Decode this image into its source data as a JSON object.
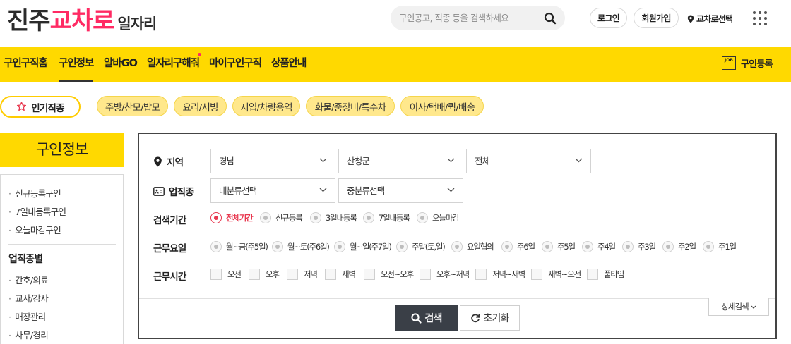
{
  "logo": {
    "part1": "진주",
    "part2": "교차로",
    "part3": "일자리"
  },
  "header": {
    "search_placeholder": "구인공고, 직종 등을 검색하세요",
    "login": "로그인",
    "join": "회원가입",
    "location": "교차로선택"
  },
  "nav": {
    "items": [
      "구인구직홈",
      "구인정보",
      "알바GO",
      "일자리구해줘",
      "마이구인구직",
      "상품안내"
    ],
    "active": "구인정보",
    "register": "구인등록",
    "job_icon_text": "JOB"
  },
  "chips": {
    "popular": "인기직종",
    "items": [
      "주방/찬모/밥모",
      "요리/서빙",
      "지입/차량용역",
      "화물/중장비/특수차",
      "이사/택배/퀵/배송"
    ]
  },
  "sidebar": {
    "title": "구인정보",
    "items": [
      "신규등록구인",
      "7일내등록구인",
      "오늘마감구인"
    ],
    "heading": "업직종별",
    "categories": [
      "간호/의료",
      "교사/강사",
      "매장관리",
      "사무/경리"
    ]
  },
  "filter": {
    "region": {
      "label": "지역",
      "selects": [
        "경남",
        "산청군",
        "전체"
      ]
    },
    "industry": {
      "label": "업직종",
      "selects": [
        "대분류선택",
        "중분류선택"
      ]
    },
    "period": {
      "label": "검색기간",
      "options": [
        "전체기간",
        "신규등록",
        "3일내등록",
        "7일내등록",
        "오늘마감"
      ],
      "selected": "전체기간"
    },
    "workdays": {
      "label": "근무요일",
      "options": [
        "월~금(주5일)",
        "월~토(주6일)",
        "월~일(주7일)",
        "주말(토,일)",
        "요일협의",
        "주6일",
        "주5일",
        "주4일",
        "주3일",
        "주2일",
        "주1일"
      ]
    },
    "worktime": {
      "label": "근무시간",
      "options": [
        "오전",
        "오후",
        "저녁",
        "새벽",
        "오전~오후",
        "오후~저녁",
        "저녁~새벽",
        "새벽~오전",
        "풀타임"
      ]
    },
    "detail": "상세검색",
    "search": "검색",
    "reset": "초기화"
  },
  "colors": {
    "brand_yellow": "#ffd900",
    "brand_pink": "#ff2a63",
    "selected_red": "#e8384f",
    "button_dark": "#3a3f47"
  }
}
